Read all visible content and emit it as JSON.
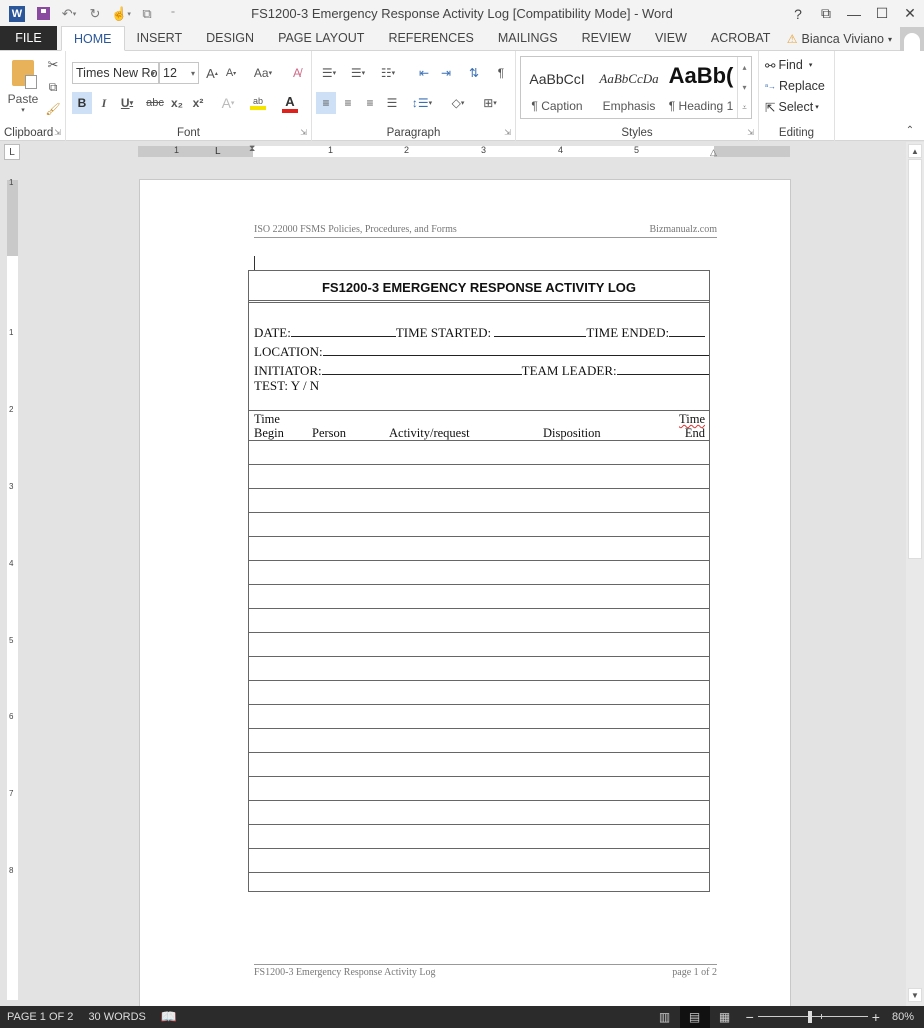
{
  "window": {
    "title": "FS1200-3 Emergency Response Activity Log [Compatibility Mode] - Word",
    "controls": {
      "help": "?",
      "restore_ribbon": "⧉",
      "minimize": "—",
      "maximize": "☐",
      "close": "✕"
    }
  },
  "quick_access": {
    "app_icon": "W",
    "icons": [
      "word-logo-icon",
      "save-icon",
      "undo-icon",
      "redo-icon",
      "touch-mode-icon",
      "customize-icon"
    ]
  },
  "tabs": [
    {
      "label": "FILE",
      "active": false
    },
    {
      "label": "HOME",
      "active": true
    },
    {
      "label": "INSERT",
      "active": false
    },
    {
      "label": "DESIGN",
      "active": false
    },
    {
      "label": "PAGE LAYOUT",
      "active": false
    },
    {
      "label": "REFERENCES",
      "active": false
    },
    {
      "label": "MAILINGS",
      "active": false
    },
    {
      "label": "REVIEW",
      "active": false
    },
    {
      "label": "VIEW",
      "active": false
    },
    {
      "label": "ACROBAT",
      "active": false
    }
  ],
  "user": {
    "name": "Bianca Viviano",
    "caret": "▾"
  },
  "ribbon": {
    "clipboard": {
      "label": "Clipboard",
      "paste": "Paste"
    },
    "font": {
      "label": "Font",
      "font_name": "Times New Ro",
      "font_size": "12",
      "grow": "A",
      "shrink": "A",
      "change_case": "Aa",
      "bold": "B",
      "italic": "I",
      "underline": "U",
      "strikethrough": "abc",
      "subscript": "x₂",
      "superscript": "x²",
      "text_effects": "A",
      "highlight": "ab",
      "font_color": "A",
      "highlight_color": "#f5e400",
      "font_color_value": "#e0201b"
    },
    "paragraph": {
      "label": "Paragraph",
      "pilcrow": "¶"
    },
    "styles": {
      "label": "Styles",
      "items": [
        {
          "sample": "AaBbCcI",
          "name": "¶ Caption"
        },
        {
          "sample": "AaBbCcDa",
          "name": "Emphasis"
        },
        {
          "sample": "AaBb(",
          "name": "¶ Heading 1"
        }
      ]
    },
    "editing": {
      "label": "Editing",
      "find": "Find",
      "replace": "Replace",
      "select": "Select"
    }
  },
  "ruler": {
    "tab_selector": "L",
    "h_numbers": [
      "1",
      "1",
      "2",
      "3",
      "4",
      "5"
    ],
    "v_numbers": [
      "1",
      "1",
      "2",
      "3",
      "4",
      "5",
      "6",
      "7",
      "8"
    ]
  },
  "document": {
    "header_left": "ISO 22000 FSMS Policies, Procedures, and Forms",
    "header_right": "Bizmanualz.com",
    "form_title": "FS1200-3 EMERGENCY RESPONSE ACTIVITY LOG",
    "fields": {
      "date": "DATE:",
      "time_started": "TIME STARTED:",
      "time_ended": "TIME ENDED:",
      "location": "LOCATION:",
      "initiator": "INITIATOR:",
      "team_leader": "TEAM LEADER:",
      "test": "TEST: Y / N"
    },
    "columns": {
      "time_begin_1": "Time",
      "time_begin_2": "Begin",
      "person": "Person",
      "activity": "Activity/request",
      "disposition": "Disposition",
      "time_end_1": "Time",
      "time_end_2": "End"
    },
    "empty_row_count": 19,
    "footer_left": "FS1200-3 Emergency Response Activity Log",
    "footer_right": "page 1 of 2"
  },
  "statusbar": {
    "page": "PAGE 1 OF 2",
    "words": "30 WORDS",
    "zoom": "80%",
    "zoom_minus": "−",
    "zoom_plus": "+"
  }
}
